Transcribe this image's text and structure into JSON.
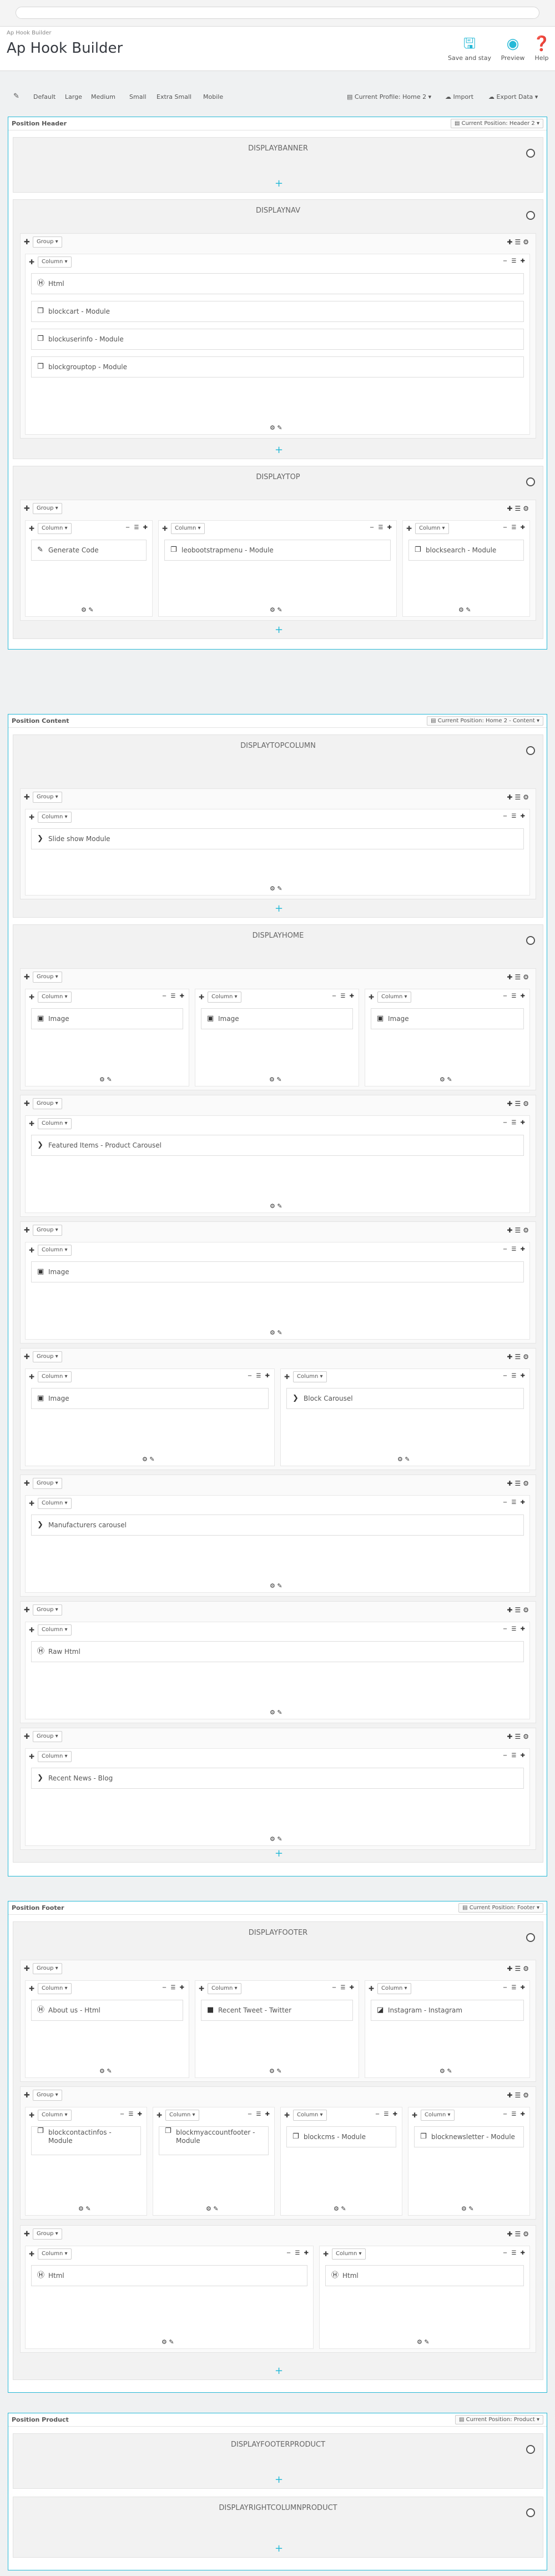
{
  "header": {
    "breadcrumb": "Ap Hook Builder",
    "title": "Ap Hook Builder",
    "save_label": "Save and stay",
    "preview_label": "Preview",
    "help_label": "Help"
  },
  "toolbar": {
    "devices": [
      "Default",
      "Large",
      "Medium",
      "Small",
      "Extra Small",
      "Mobile"
    ],
    "profile": "Current Profile: Home 2",
    "import_label": "Import",
    "export_label": "Export Data"
  },
  "labels": {
    "group": "Group",
    "column": "Column"
  },
  "positions": {
    "header": {
      "title": "Position Header",
      "btn": "Current Position: Header 2"
    },
    "content": {
      "title": "Position Content",
      "btn": "Current Position: Home 2 - Content"
    },
    "footer": {
      "title": "Position Footer",
      "btn": "Current Position: Footer"
    },
    "product": {
      "title": "Position Product",
      "btn": "Current Position: Product"
    }
  },
  "hooks": {
    "displaybanner": "DISPLAYBANNER",
    "displaynav": "DISPLAYNAV",
    "displaytop": "DISPLAYTOP",
    "displaytopcolumn": "DISPLAYTOPCOLUMN",
    "displayhome": "DISPLAYHOME",
    "displayfooter": "DISPLAYFOOTER",
    "displayfooterproduct": "DISPLAYFOOTERPRODUCT",
    "displayrightcolumnproduct": "DISPLAYRIGHTCOLUMNPRODUCT"
  },
  "widgets": {
    "nav_html": "Html",
    "nav_cart": "blockcart - Module",
    "nav_userinfo": "blockuserinfo - Module",
    "nav_grouptop": "blockgrouptop - Module",
    "top_generate": "Generate Code",
    "top_megamenu": "leobootstrapmenu - Module",
    "top_search": "blocksearch - Module",
    "tc_slideshow": "Slide show Module",
    "home_img1": "Image",
    "home_img2": "Image",
    "home_img3": "Image",
    "home_featured": "Featured Items - Product Carousel",
    "home_img4": "Image",
    "home_img5": "Image",
    "home_block_carousel": "Block Carousel",
    "home_manufacturers": "Manufacturers carousel",
    "home_rawhtml": "Raw Html",
    "home_news": "Recent News - Blog",
    "f_about": "About us - Html",
    "f_tweet": "Recent Tweet - Twitter",
    "f_insta": "Instagram - Instagram",
    "f_contact_1": "blockcontactinfos -",
    "f_contact_2": "Module",
    "f_myaccount_1": "blockmyaccountfooter -",
    "f_myaccount_2": "Module",
    "f_cms": "blockcms - Module",
    "f_newsletter": "blocknewsletter - Module",
    "f_html1": "Html",
    "f_html2": "Html"
  },
  "icons": {
    "save": "save-icon",
    "preview": "eye-icon",
    "help": "question-icon"
  },
  "colors": {
    "accent": "#25b9d7"
  }
}
